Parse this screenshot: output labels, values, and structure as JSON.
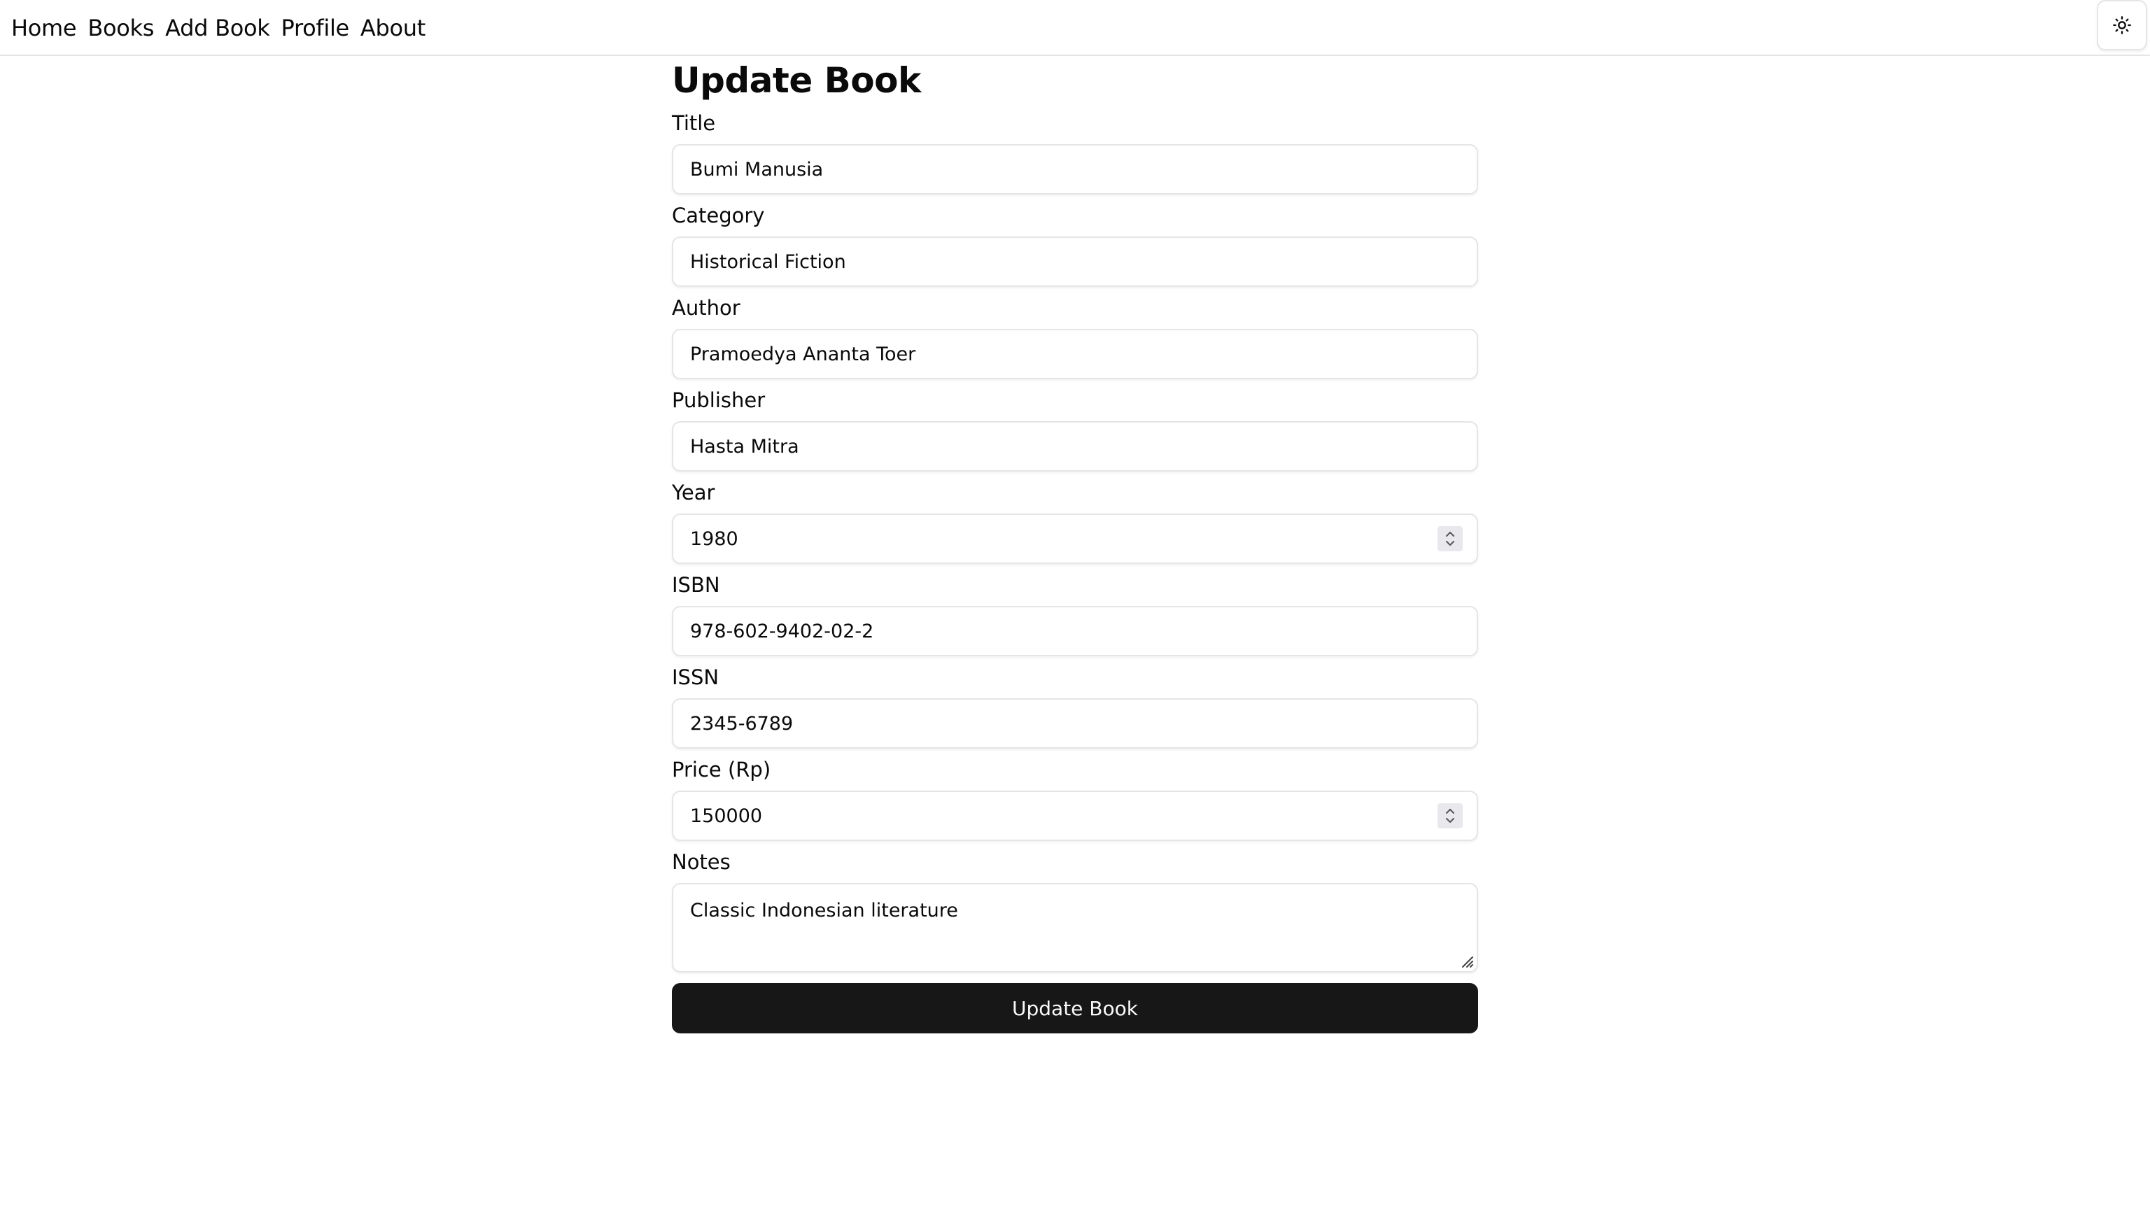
{
  "nav": {
    "items": [
      {
        "label": "Home"
      },
      {
        "label": "Books"
      },
      {
        "label": "Add Book"
      },
      {
        "label": "Profile"
      },
      {
        "label": "About"
      }
    ],
    "theme_toggle_icon": "sun-icon"
  },
  "page": {
    "title": "Update Book"
  },
  "form": {
    "title": {
      "label": "Title",
      "value": "Bumi Manusia"
    },
    "category": {
      "label": "Category",
      "value": "Historical Fiction"
    },
    "author": {
      "label": "Author",
      "value": "Pramoedya Ananta Toer"
    },
    "publisher": {
      "label": "Publisher",
      "value": "Hasta Mitra"
    },
    "year": {
      "label": "Year",
      "value": "1980"
    },
    "isbn": {
      "label": "ISBN",
      "value": "978-602-9402-02-2"
    },
    "issn": {
      "label": "ISSN",
      "value": "2345-6789"
    },
    "price": {
      "label": "Price (Rp)",
      "value": "150000"
    },
    "notes": {
      "label": "Notes",
      "value": "Classic Indonesian literature"
    },
    "submit_label": "Update Book"
  },
  "colors": {
    "button_bg": "#171717",
    "button_text": "#fafafa",
    "border": "#e5e5e5",
    "text": "#0a0a0a"
  }
}
